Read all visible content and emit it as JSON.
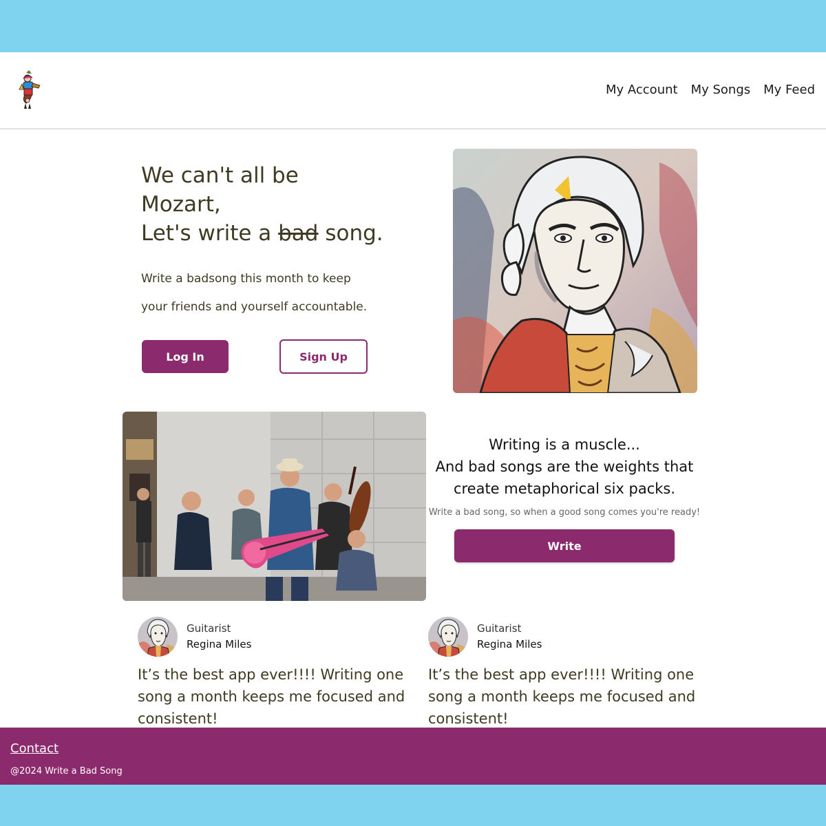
{
  "header": {
    "logo_icon": "jester-musician-logo-icon",
    "nav": [
      "My Account",
      "My Songs",
      "My Feed"
    ]
  },
  "hero": {
    "title_line1": "We can't all be",
    "title_line2": "Mozart,",
    "title_line3_pre": "Let's write a ",
    "title_line3_strike": "bad",
    "title_line3_post": " song.",
    "subtitle_line1": "Write a badsong this month to keep",
    "subtitle_line2": "your friends and yourself accountable.",
    "login_label": "Log In",
    "signup_label": "Sign Up",
    "image": "mozart-painting-image"
  },
  "muscle": {
    "image": "street-band-photo",
    "line1": "Writing is a muscle...",
    "line2": "And bad songs are the weights that",
    "line3": "create metaphorical six packs.",
    "subtext": "Write a bad song, so when a good song comes you're ready!",
    "write_label": "Write"
  },
  "testimonials": [
    {
      "role": "Guitarist",
      "name": "Regina Miles",
      "quote": "It’s the best app ever!!!! Writing one song a month keeps me focused and consistent!"
    },
    {
      "role": "Guitarist",
      "name": "Regina Miles",
      "quote": "It’s the best app ever!!!! Writing one song a month keeps me focused and consistent!"
    }
  ],
  "footer": {
    "contact": "Contact",
    "copyright": "@2024 Write a Bad Song"
  },
  "colors": {
    "brand": "#8b2a6c",
    "outer_background": "#7fd3ee",
    "text": "#3f3a22"
  }
}
